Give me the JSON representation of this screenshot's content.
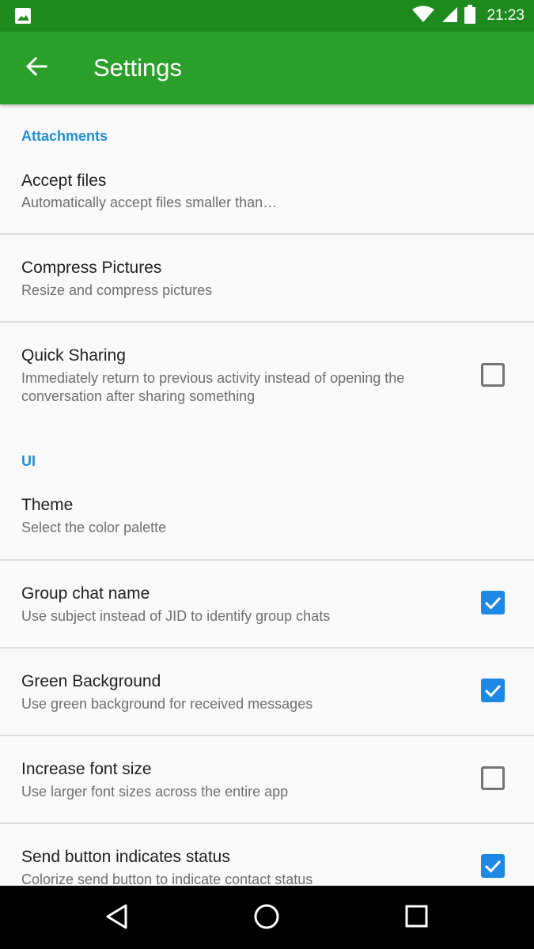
{
  "status_bar": {
    "time": "21:23",
    "icons": [
      "image-notification-icon",
      "wifi-icon",
      "cellular-signal-icon",
      "battery-icon"
    ]
  },
  "app_bar": {
    "title": "Settings",
    "back_icon": "arrow-back-icon"
  },
  "sections": {
    "attachments": {
      "header": "Attachments",
      "items": [
        {
          "title": "Accept files",
          "summary": "Automatically accept files smaller than…"
        },
        {
          "title": "Compress Pictures",
          "summary": "Resize and compress pictures"
        },
        {
          "title": "Quick Sharing",
          "summary": "Immediately return to previous activity instead of opening the conversation after sharing something",
          "checked": false
        }
      ]
    },
    "ui": {
      "header": "UI",
      "items": [
        {
          "title": "Theme",
          "summary": "Select the color palette"
        },
        {
          "title": "Group chat name",
          "summary": "Use subject instead of JID to identify group chats",
          "checked": true
        },
        {
          "title": "Green Background",
          "summary": "Use green background for received messages",
          "checked": true
        },
        {
          "title": "Increase font size",
          "summary": "Use larger font sizes across the entire app",
          "checked": false
        },
        {
          "title": "Send button indicates status",
          "summary": "Colorize send button to indicate contact status",
          "checked": true
        }
      ]
    }
  },
  "colors": {
    "status_bar": "#1e8a1e",
    "app_bar": "#2aa02a",
    "accent": "#1e90d6",
    "checkbox_on": "#1e88e5"
  },
  "nav_bar": {
    "icons": [
      "back-triangle-icon",
      "home-circle-icon",
      "recents-square-icon"
    ]
  }
}
